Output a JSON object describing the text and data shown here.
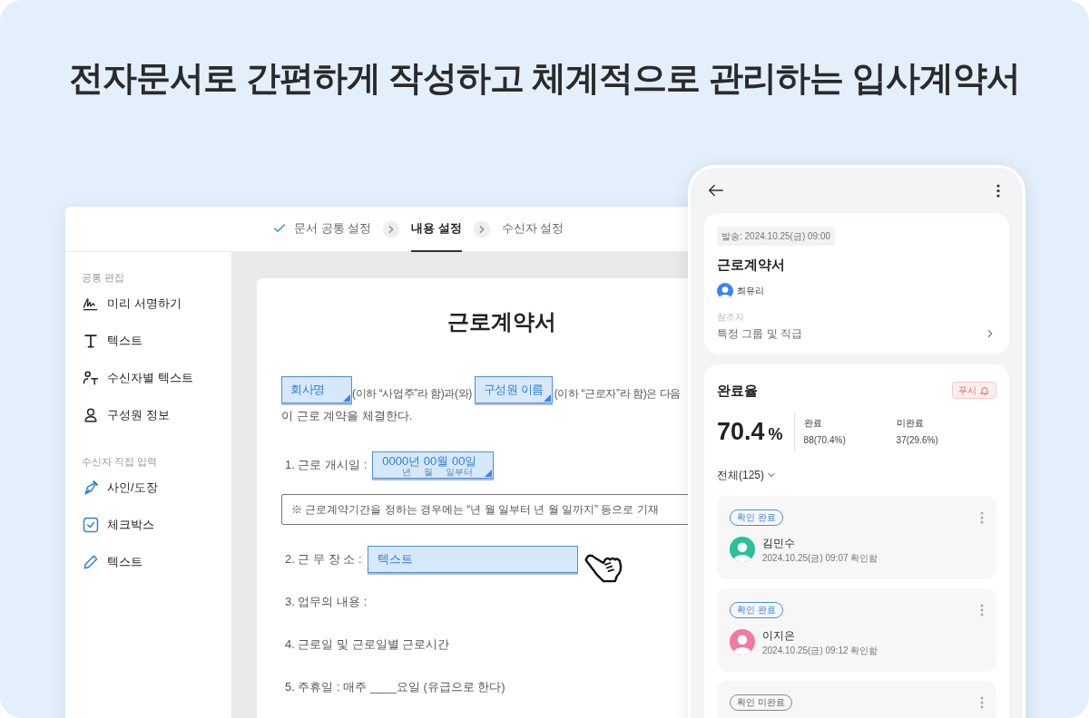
{
  "headline": "전자문서로 간편하게 작성하고 체계적으로 관리하는 입사계약서",
  "editor": {
    "steps": [
      {
        "label": "문서 공통 설정",
        "completed": true,
        "selected": false
      },
      {
        "label": "내용 설정",
        "completed": false,
        "selected": true
      },
      {
        "label": "수신자 설정",
        "completed": false,
        "selected": false
      }
    ],
    "sidebar": [
      {
        "title": "공통 편집",
        "items": [
          {
            "label": "미리 서명하기",
            "kind": "signature"
          },
          {
            "label": "텍스트",
            "kind": "text"
          },
          {
            "label": "수신자별 텍스트",
            "kind": "recipient-text"
          },
          {
            "label": "구성원 정보",
            "kind": "member"
          }
        ]
      },
      {
        "title": "수신자 직접 입력",
        "items": [
          {
            "label": "사인/도장",
            "kind": "pen"
          },
          {
            "label": "체크박스",
            "kind": "checkbox"
          },
          {
            "label": "텍스트",
            "kind": "pencil"
          }
        ]
      }
    ],
    "document": {
      "title": "근로계약서",
      "intro": {
        "field_1": "회사명",
        "text_1": "(이하 “사업주”라 함)과(와)",
        "field_2": "구성원 이름",
        "text_2": "(이하 “근로자”라 함)은 다음",
        "line_2": "이 근로 계약을 체결한다."
      },
      "items": [
        {
          "kind": "date",
          "label": "1. 근로 개시일 :",
          "value": "0000년 00월 00일",
          "underlying": "년     월     일부터"
        },
        {
          "kind": "note",
          "text": "※ 근로계약기간을 정하는 경우에는 “년 월 일부터 년 월 일까지” 등으로 기재"
        },
        {
          "kind": "field",
          "label": "2. 근 무 장 소 :",
          "value": "텍스트"
        },
        {
          "kind": "text",
          "text": "3. 업무의 내용 :"
        },
        {
          "kind": "text",
          "text": "4. 근로일 및 근로일별 근로시간"
        },
        {
          "kind": "text",
          "text": "5. 주휴일 : 매주 ____요일 (유급으로 한다)"
        }
      ]
    }
  },
  "phone": {
    "sent": "발송: 2024.10.25(금) 09:00",
    "title": "근로계약서",
    "sender": {
      "name": "최유리",
      "color": "#3b82f6"
    },
    "ref_label": "참조자",
    "ref_value": "특정 그룹 및 직급",
    "completion": {
      "title": "완료율",
      "push": "푸시",
      "rate": "70.4",
      "unit": "%",
      "stats": [
        {
          "label": "완료",
          "value": "88(70.4%)"
        },
        {
          "label": "미완료",
          "value": "37(29.6%)"
        }
      ],
      "filter": "전체(125)",
      "recipients": [
        {
          "status": "확인 완료",
          "confirmed": true,
          "name": "김민수",
          "time": "2024.10.25(금) 09:07 확인함",
          "color": "#2bbf9b"
        },
        {
          "status": "확인 완료",
          "confirmed": true,
          "name": "이지은",
          "time": "2024.10.25(금) 09:12 확인함",
          "color": "#f07aa0"
        },
        {
          "status": "확인 미완료",
          "confirmed": false
        }
      ]
    }
  }
}
